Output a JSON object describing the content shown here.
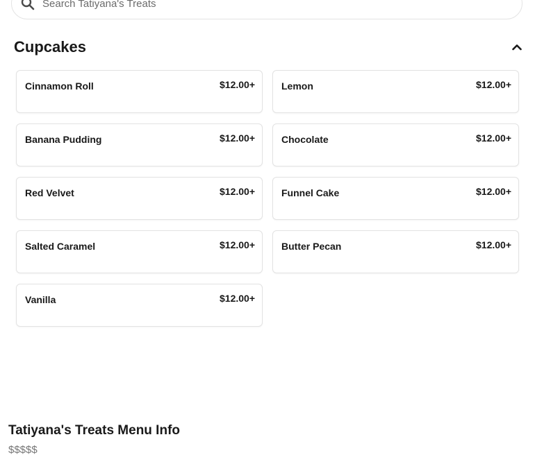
{
  "search": {
    "placeholder": "Search Tatiyana's Treats"
  },
  "section": {
    "title": "Cupcakes",
    "toggle_icon": "chevron-up-icon"
  },
  "items": [
    {
      "name": "Cinnamon Roll",
      "price": "$12.00+"
    },
    {
      "name": "Lemon",
      "price": "$12.00+"
    },
    {
      "name": "Banana Pudding",
      "price": "$12.00+"
    },
    {
      "name": "Chocolate",
      "price": "$12.00+"
    },
    {
      "name": "Red Velvet",
      "price": "$12.00+"
    },
    {
      "name": "Funnel Cake",
      "price": "$12.00+"
    },
    {
      "name": "Salted Caramel",
      "price": "$12.00+"
    },
    {
      "name": "Butter Pecan",
      "price": "$12.00+"
    },
    {
      "name": "Vanilla",
      "price": "$12.00+"
    }
  ],
  "menu_info": {
    "title": "Tatiyana's Treats Menu Info",
    "price_range": "$$$$$"
  },
  "colors": {
    "text": "#191919",
    "muted": "#767676",
    "border": "#e2e2e2"
  }
}
